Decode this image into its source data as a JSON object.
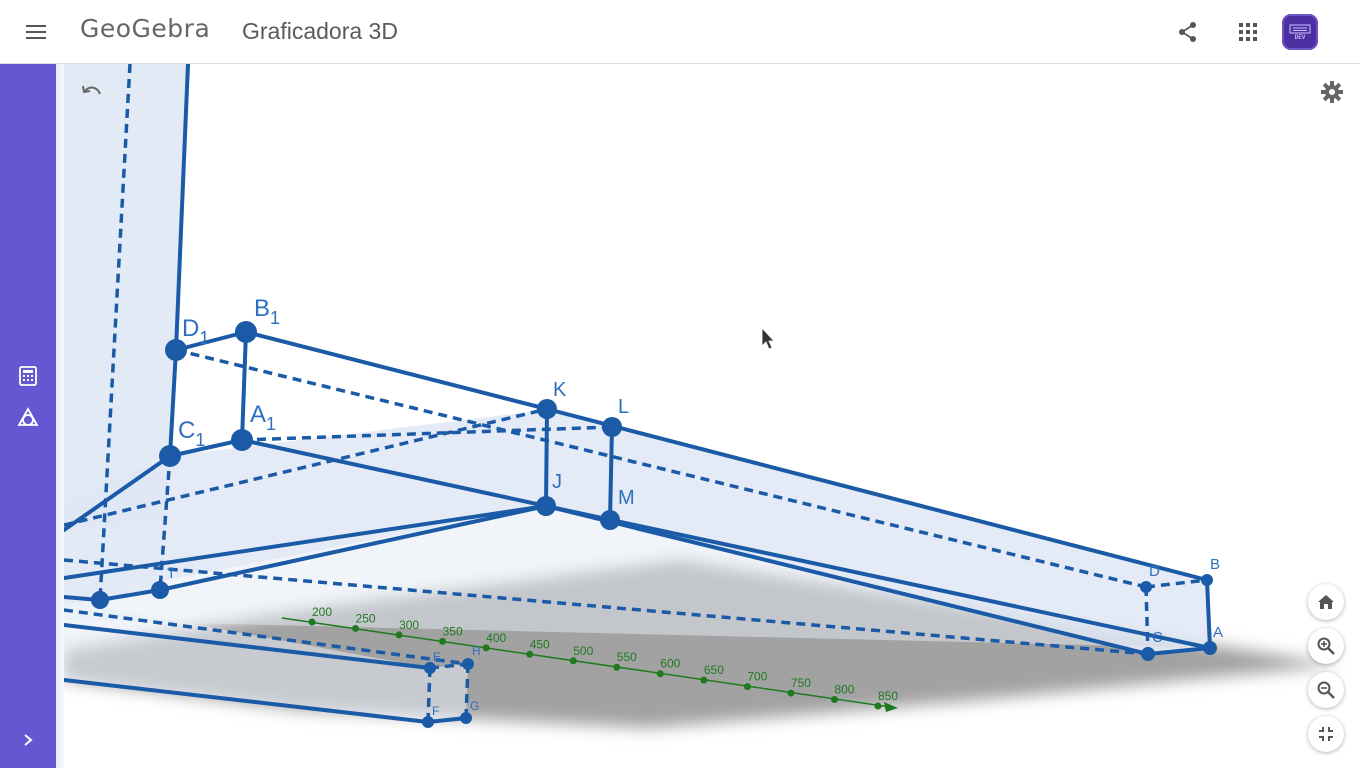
{
  "app": {
    "logo_text": "GeoGebra",
    "title": "Graficadora 3D",
    "avatar_text": "DEV"
  },
  "colors": {
    "sidebar": "#6557d2",
    "solid_edge": "#1a5aa6",
    "face_fill": "#dfe8f4",
    "axis": "#1f7a1f",
    "point_label": "#2d6fc0"
  },
  "icons": {
    "menu": "menu-icon",
    "share": "share-icon",
    "apps": "apps-grid-icon",
    "algebra": "calculator-icon",
    "tools": "shapes-tools-icon",
    "expand": "chevron-right-icon",
    "undo": "undo-icon",
    "settings": "gear-icon",
    "home": "home-icon",
    "zoom_in": "zoom-in-icon",
    "zoom_out": "zoom-out-icon",
    "exit_fullscreen": "exit-fullscreen-icon"
  },
  "point_labels": {
    "D1": "D",
    "B1": "B",
    "C1": "C",
    "A1": "A",
    "sub1": "1",
    "K": "K",
    "L": "L",
    "J": "J",
    "M": "M",
    "D": "D",
    "B": "B",
    "C": "C",
    "A": "A",
    "E": "E",
    "H": "H",
    "F": "F",
    "G": "G",
    "T": "T"
  },
  "axis_ticks": [
    "200",
    "250",
    "300",
    "350",
    "400",
    "450",
    "500",
    "550",
    "600",
    "650",
    "700",
    "750",
    "800",
    "850"
  ]
}
